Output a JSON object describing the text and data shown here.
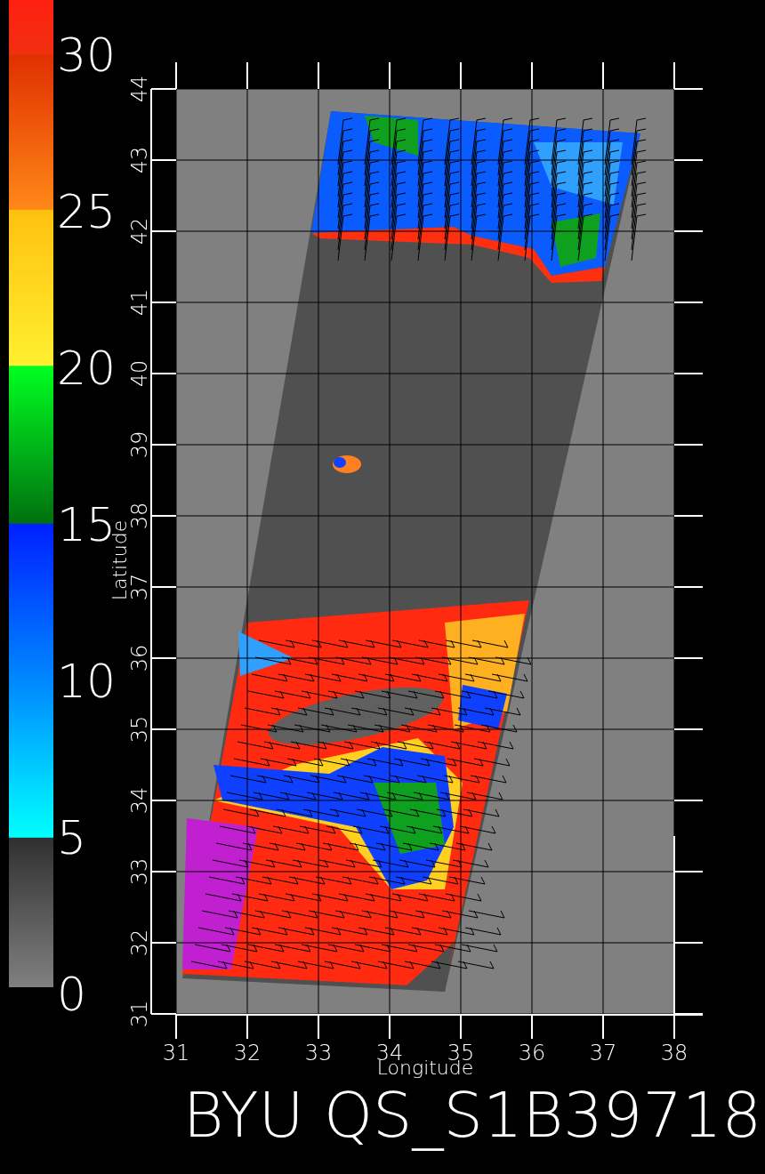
{
  "color_scale": {
    "labels": [
      "30",
      "25",
      "20",
      "15",
      "10",
      "5",
      "0"
    ]
  },
  "map": {
    "x_ticks": [
      "31",
      "32",
      "33",
      "34",
      "35",
      "36",
      "37",
      "38"
    ],
    "y_ticks": [
      "31",
      "32",
      "33",
      "34",
      "35",
      "36",
      "37",
      "38",
      "39",
      "40",
      "41",
      "42",
      "43",
      "44"
    ],
    "xlabel": "Longitude",
    "ylabel": "Latitude"
  },
  "title": "BYU QS_S1B39718"
}
